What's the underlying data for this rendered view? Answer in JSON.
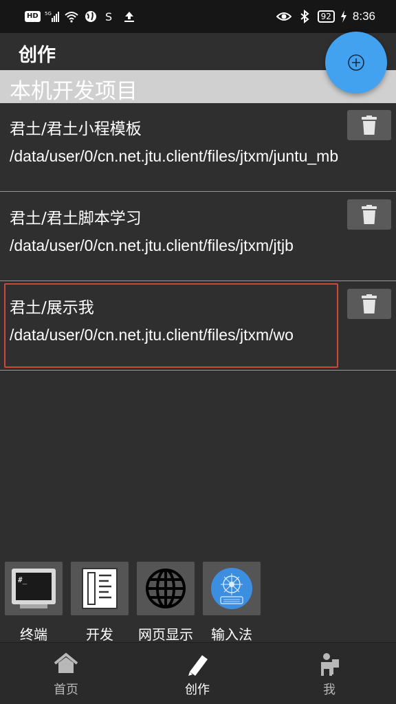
{
  "status_bar": {
    "hd": "HD",
    "battery": "92",
    "time": "8:36"
  },
  "app_bar": {
    "title": "创作",
    "fab_icon": "add-circle-icon"
  },
  "section": {
    "title": "本机开发项目"
  },
  "projects": [
    {
      "name": "君土/君土小程模板",
      "path": "/data/user/0/cn.net.jtu.client/files/jtxm/juntu_mb",
      "delete_icon": "trash-icon"
    },
    {
      "name": "君土/君土脚本学习",
      "path": "/data/user/0/cn.net.jtu.client/files/jtxm/jtjb",
      "delete_icon": "trash-icon"
    },
    {
      "name": "君土/展示我",
      "path": "/data/user/0/cn.net.jtu.client/files/jtxm/wo",
      "delete_icon": "trash-icon"
    }
  ],
  "tools": [
    {
      "label": "终端",
      "icon": "terminal-icon"
    },
    {
      "label": "开发",
      "icon": "document-icon"
    },
    {
      "label": "网页显示",
      "icon": "globe-icon"
    },
    {
      "label": "输入法",
      "icon": "keyboard-icon"
    }
  ],
  "bottom_nav": [
    {
      "label": "首页",
      "icon": "home-icon",
      "active": false
    },
    {
      "label": "创作",
      "icon": "pencil-icon",
      "active": true
    },
    {
      "label": "我",
      "icon": "user-icon",
      "active": false
    }
  ],
  "colors": {
    "background": "#2f2f2f",
    "accent_fab": "#42a2f0",
    "section_header": "#d0d0d0",
    "highlight_border": "#d0483a",
    "nav_inactive": "#b8b8b8",
    "nav_active": "#ffffff"
  }
}
